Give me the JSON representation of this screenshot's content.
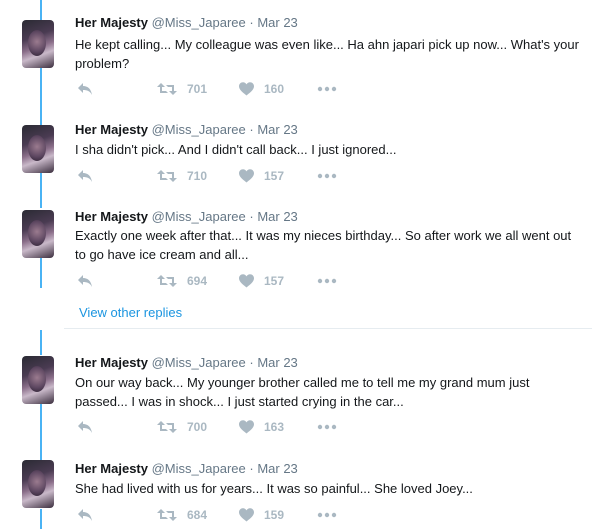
{
  "tweets": [
    {
      "name": "Her Majesty",
      "handle": "@Miss_Japaree",
      "sep": "·",
      "date": "Mar 23",
      "text": "He kept calling... My colleague was even like... Ha ahn japari pick up now... What's your problem?",
      "retweets": "701",
      "likes": "160"
    },
    {
      "name": "Her Majesty",
      "handle": "@Miss_Japaree",
      "sep": "·",
      "date": "Mar 23",
      "text": "I sha didn't pick... And I didn't call back... I just ignored...",
      "retweets": "710",
      "likes": "157"
    },
    {
      "name": "Her Majesty",
      "handle": "@Miss_Japaree",
      "sep": "·",
      "date": "Mar 23",
      "text": "Exactly one week after that... It was my nieces birthday... So after work we all went out to go have ice cream and all...",
      "retweets": "694",
      "likes": "157"
    },
    {
      "name": "Her Majesty",
      "handle": "@Miss_Japaree",
      "sep": "·",
      "date": "Mar 23",
      "text": "On our way back... My younger brother called me to tell me my grand mum just passed... I was in shock... I just started crying in the car...",
      "retweets": "700",
      "likes": "163"
    },
    {
      "name": "Her Majesty",
      "handle": "@Miss_Japaree",
      "sep": "·",
      "date": "Mar 23",
      "text": "She had lived with us for years... It was so painful... She loved Joey...",
      "retweets": "684",
      "likes": "159"
    }
  ],
  "view_other_replies": "View other replies",
  "colors": {
    "thread_line": "#4ab3f4",
    "link": "#1b95e0",
    "action": "#aab8c2"
  },
  "icons": [
    "reply-icon",
    "retweet-icon",
    "like-icon",
    "more-icon"
  ]
}
